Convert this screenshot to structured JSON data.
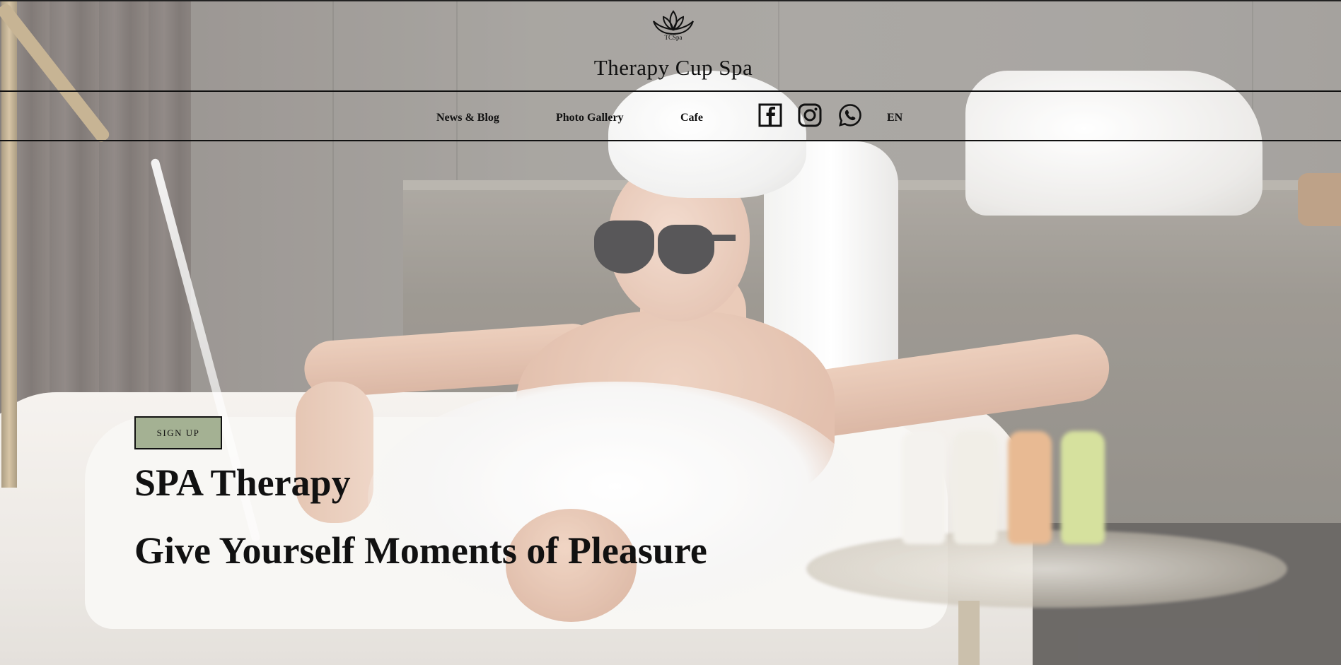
{
  "header": {
    "logo_text": "TCSpa",
    "site_title": "Therapy Cup Spa"
  },
  "nav": {
    "items": [
      {
        "label": "News & Blog"
      },
      {
        "label": "Photo Gallery"
      },
      {
        "label": "Cafe"
      }
    ],
    "social": [
      "facebook-icon",
      "instagram-icon",
      "whatsapp-icon"
    ],
    "language": "EN"
  },
  "hero": {
    "signup_label": "SIGN UP",
    "heading": "SPA Therapy",
    "subheading": "Give Yourself Moments of Pleasure"
  },
  "colors": {
    "signup_bg": "#a4b193",
    "text": "#111111"
  }
}
